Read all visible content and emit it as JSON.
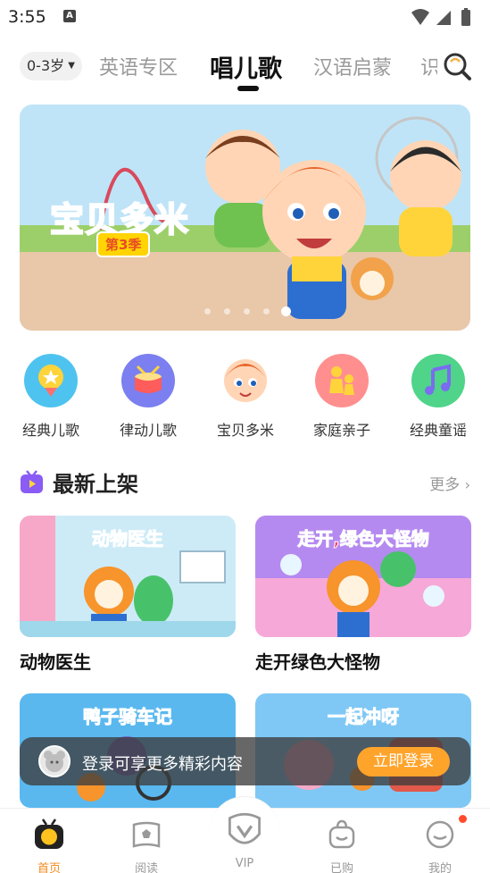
{
  "status_bar": {
    "time": "3:55",
    "notif_letter": "A"
  },
  "top_nav": {
    "age_filter": "0-3岁",
    "tabs": [
      {
        "label": "英语专区",
        "active": false
      },
      {
        "label": "唱儿歌",
        "active": true
      },
      {
        "label": "汉语启蒙",
        "active": false
      },
      {
        "label": "识",
        "active": false
      }
    ]
  },
  "banner": {
    "title": "宝贝多米",
    "subtitle": "第3季",
    "dot_count": 5,
    "active_dot": 4
  },
  "categories": [
    {
      "label": "经典儿歌",
      "icon": "medal-icon",
      "color": "#4fc3ef"
    },
    {
      "label": "律动儿歌",
      "icon": "drum-icon",
      "color": "#7b7ff0"
    },
    {
      "label": "宝贝多米",
      "icon": "character-avatar",
      "color": "#f7d8c0"
    },
    {
      "label": "家庭亲子",
      "icon": "family-icon",
      "color": "#ff8f8f"
    },
    {
      "label": "经典童谣",
      "icon": "music-note-icon",
      "color": "#4fd48a"
    }
  ],
  "section": {
    "title": "最新上架",
    "more": "更多"
  },
  "cards": [
    {
      "title": "动物医生",
      "caption": "动物医生",
      "bg": "#cdebf7"
    },
    {
      "title": "走开绿色大怪物",
      "caption": "走开,绿色大怪物",
      "bg": "#f6a8d8"
    },
    {
      "title": "",
      "caption": "鸭子骑车记",
      "bg": "#5ab8ef"
    },
    {
      "title": "",
      "caption": "一起冲呀",
      "bg": "#7fc8f5"
    }
  ],
  "login_bar": {
    "text": "登录可享更多精彩内容",
    "button": "立即登录"
  },
  "bottom_nav": [
    {
      "label": "首页",
      "icon": "home-tv-icon",
      "active": true
    },
    {
      "label": "阅读",
      "icon": "book-icon",
      "active": false
    },
    {
      "label": "VIP",
      "icon": "vip-crown-icon",
      "active": false
    },
    {
      "label": "已购",
      "icon": "bag-icon",
      "active": false
    },
    {
      "label": "我的",
      "icon": "profile-icon",
      "active": false
    }
  ],
  "colors": {
    "accent": "#f08a1c",
    "login_button": "#ffa42b",
    "section_icon": "#8a5cf5"
  }
}
